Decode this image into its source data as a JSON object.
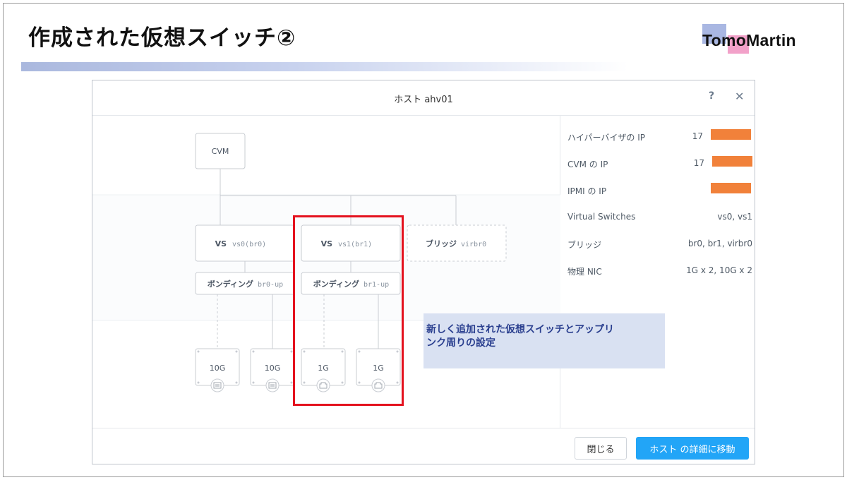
{
  "slide": {
    "title": "作成された仮想スイッチ②",
    "logo": {
      "prefix": "Tomo",
      "suffix": "Martin"
    }
  },
  "modal": {
    "title": "ホスト ahv01",
    "help": "?",
    "close": "✕",
    "diagram": {
      "cvm": "CVM",
      "vs0": {
        "label": "VS",
        "name": "vs0(br0)"
      },
      "vs1": {
        "label": "VS",
        "name": "vs1(br1)"
      },
      "bridge": {
        "label": "ブリッジ",
        "name": "virbr0"
      },
      "bond0": {
        "label": "ボンディング",
        "name": "br0-up"
      },
      "bond1": {
        "label": "ボンディング",
        "name": "br1-up"
      },
      "nics": [
        "10G",
        "10G",
        "1G",
        "1G"
      ]
    },
    "info": [
      {
        "label": "ハイパーバイザの IP",
        "value": "17"
      },
      {
        "label": "CVM の IP",
        "value": "17"
      },
      {
        "label": "IPMI の IP",
        "value": ""
      },
      {
        "label": "Virtual Switches",
        "value": "vs0, vs1"
      },
      {
        "label": "ブリッジ",
        "value": "br0, br1, virbr0"
      },
      {
        "label": "物理 NIC",
        "value": "1G x 2, 10G x 2"
      }
    ],
    "buttons": {
      "close": "閉じる",
      "go": "ホスト の詳細に移動"
    }
  },
  "callout": {
    "line1": "新しく追加された仮想スイッチとアップリ",
    "line2": "ンク周りの設定"
  },
  "colors": {
    "accent": "#22a5f7",
    "highlight": "#e4121e",
    "redact": "#f1813a",
    "callout_bg": "#d9e1f2"
  }
}
